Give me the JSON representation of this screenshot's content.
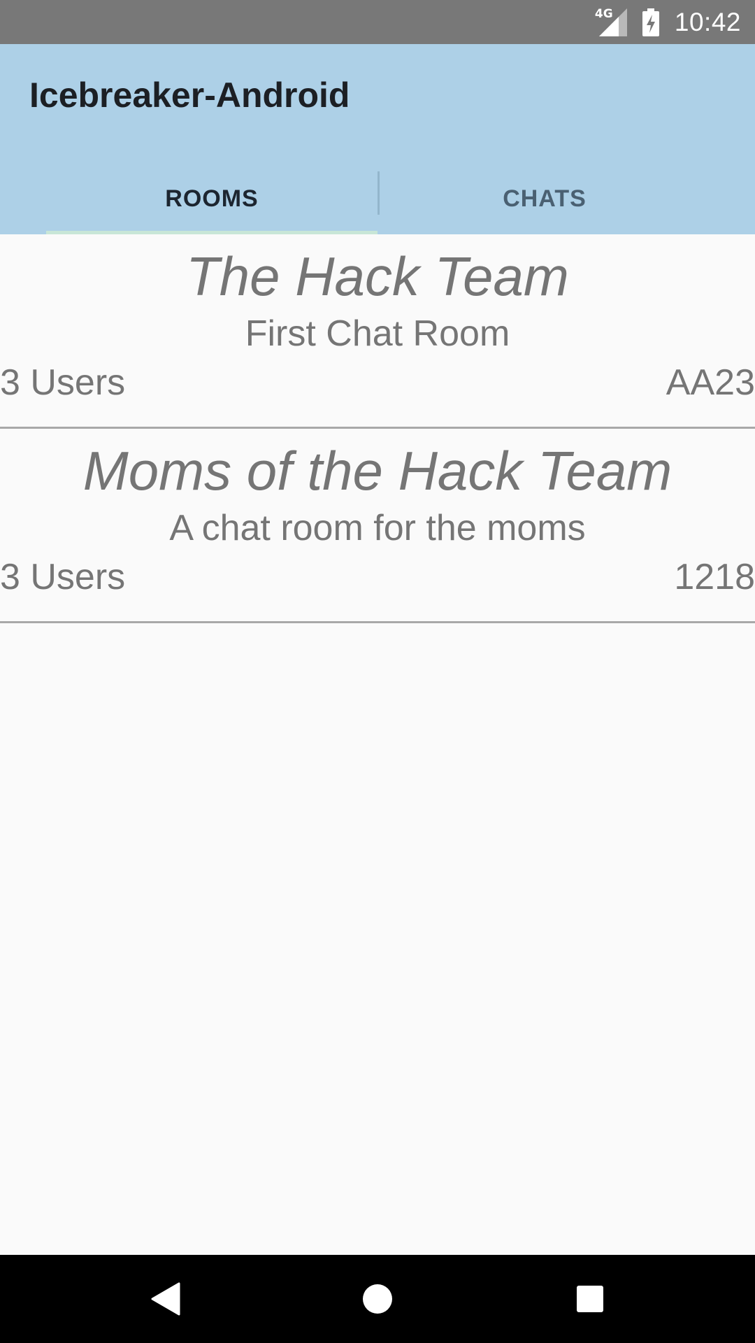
{
  "status_bar": {
    "network": "4G",
    "time": "10:42",
    "icons": [
      "signal-icon",
      "battery-charging-icon"
    ]
  },
  "app_bar": {
    "title": "Icebreaker-Android",
    "background_color": "#add0e7"
  },
  "tabs": [
    {
      "label": "ROOMS",
      "selected": true
    },
    {
      "label": "CHATS",
      "selected": false
    }
  ],
  "rooms": [
    {
      "name": "The Hack Team",
      "description": "First Chat Room",
      "users": "3 Users",
      "code": "AA23"
    },
    {
      "name": "Moms of the Hack Team",
      "description": "A chat room for the moms",
      "users": "3 Users",
      "code": "1218"
    }
  ],
  "nav_bar": {
    "icons": [
      "back-icon",
      "home-icon",
      "recents-icon"
    ]
  }
}
